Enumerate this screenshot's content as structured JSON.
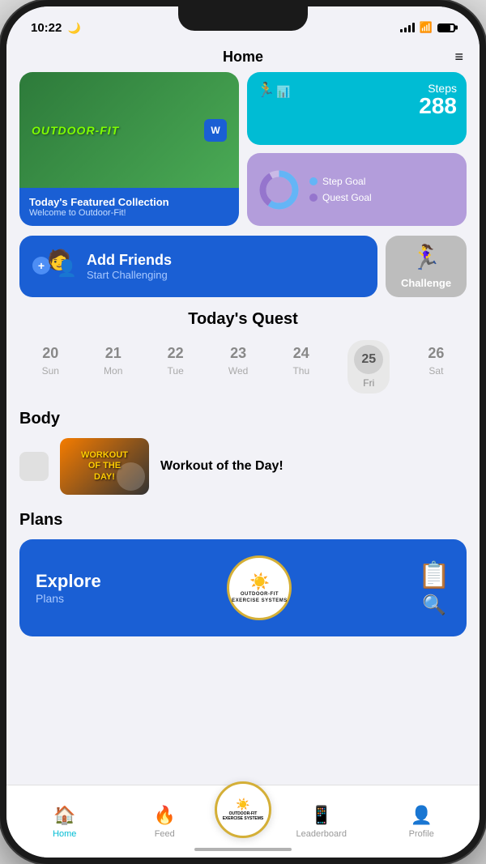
{
  "status_bar": {
    "time": "10:22",
    "moon": "🌙"
  },
  "header": {
    "title": "Home",
    "menu_label": "☰"
  },
  "featured_card": {
    "brand": "OUTDOOR-FIT",
    "logo_letter": "W",
    "title": "Today's Featured Collection",
    "subtitle": "Welcome to Outdoor-Fit!"
  },
  "steps_card": {
    "label": "Steps",
    "count": "288"
  },
  "goals_card": {
    "step_goal_label": "Step Goal",
    "quest_goal_label": "Quest Goal",
    "step_goal_color": "#64b5f6",
    "quest_goal_color": "#9575cd"
  },
  "add_friends_card": {
    "title": "Add Friends",
    "subtitle": "Start Challenging"
  },
  "challenge_card": {
    "label": "Challenge"
  },
  "quest_section": {
    "title": "Today's Quest"
  },
  "calendar": {
    "days": [
      {
        "num": "20",
        "name": "Sun",
        "active": false
      },
      {
        "num": "21",
        "name": "Mon",
        "active": false
      },
      {
        "num": "22",
        "name": "Tue",
        "active": false
      },
      {
        "num": "23",
        "name": "Wed",
        "active": false
      },
      {
        "num": "24",
        "name": "Thu",
        "active": false
      },
      {
        "num": "25",
        "name": "Fri",
        "active": true
      },
      {
        "num": "26",
        "name": "Sat",
        "active": false
      }
    ]
  },
  "body_section": {
    "label": "Body",
    "workout_name": "Workout of the Day!"
  },
  "plans_section": {
    "label": "Plans",
    "explore": "Explore",
    "subtitle": "Plans"
  },
  "bottom_nav": {
    "items": [
      {
        "label": "Home",
        "active": true
      },
      {
        "label": "Feed",
        "active": false
      },
      {
        "label": "",
        "active": false,
        "center": true
      },
      {
        "label": "Leaderboard",
        "active": false
      },
      {
        "label": "Profile",
        "active": false
      }
    ]
  }
}
